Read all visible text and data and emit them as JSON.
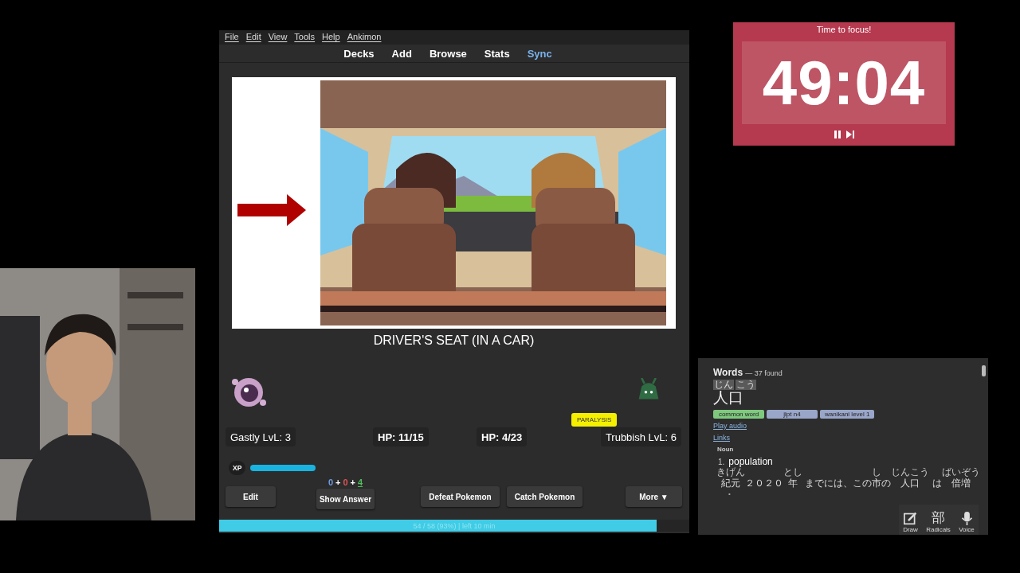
{
  "anki": {
    "menu": [
      "File",
      "Edit",
      "View",
      "Tools",
      "Help",
      "Ankimon"
    ],
    "toolbar": [
      {
        "label": "Decks",
        "highlighted": false
      },
      {
        "label": "Add",
        "highlighted": false
      },
      {
        "label": "Browse",
        "highlighted": false
      },
      {
        "label": "Stats",
        "highlighted": false
      },
      {
        "label": "Sync",
        "highlighted": true
      }
    ],
    "card": {
      "answer": "DRIVER'S SEAT (IN A CAR)"
    },
    "battle": {
      "status_badge": "PARALYSIS",
      "player_name": "Gastly LvL: 3",
      "player_hp": "HP: 11/15",
      "enemy_hp": "HP: 4/23",
      "enemy_name": "Trubbish LvL: 6",
      "xp_label": "XP",
      "xp": {
        "level": 0.16
      }
    },
    "counts": [
      {
        "value": "0",
        "color": "#6f9ce6",
        "selected": false
      },
      {
        "value": "0",
        "color": "#e05555",
        "selected": false
      },
      {
        "value": "4",
        "color": "#4fbf5a",
        "selected": true
      }
    ],
    "count_separator": "+",
    "buttons": [
      "Edit",
      "Show Answer",
      "Defeat Pokemon",
      "Catch Pokemon",
      "More ▼"
    ],
    "progress": {
      "level": 0.93,
      "text": "54 / 58 (93%) | left 10 min"
    }
  },
  "timer": {
    "title": "Time to focus!",
    "time": "49:04"
  },
  "dictionary": {
    "heading": "Words",
    "count": "— 37 found",
    "reading": [
      {
        "text": "じん"
      },
      {
        "text": "こう"
      }
    ],
    "word": "人口",
    "tags": [
      {
        "label": "common word",
        "color": "#7fc97f"
      },
      {
        "label": "jlpt n4",
        "color": "#9aa6c9"
      },
      {
        "label": "wanikani level 1",
        "color": "#9aa6c9"
      }
    ],
    "links": [
      "Play audio",
      "Links"
    ],
    "part_of_speech": "Noun",
    "sense_number": "1.",
    "meaning": "population",
    "sentence": [
      {
        "text": "紀元",
        "reading": "きげん"
      },
      {
        "text": "２０２０"
      },
      {
        "text": "年",
        "reading": "とし"
      },
      {
        "text": " までには、この"
      },
      {
        "text": "市",
        "reading": "し"
      },
      {
        "text": "の"
      },
      {
        "text": "人口",
        "reading": "じんこう"
      },
      {
        "text": " は"
      },
      {
        "text": "倍増",
        "reading": "ばいぞう"
      }
    ],
    "bullet": "•",
    "tools": [
      {
        "kind": "draw",
        "label": "Draw"
      },
      {
        "kind": "radicals",
        "label": "Radicals",
        "glyph": "部"
      },
      {
        "kind": "voice",
        "label": "Voice"
      }
    ]
  }
}
